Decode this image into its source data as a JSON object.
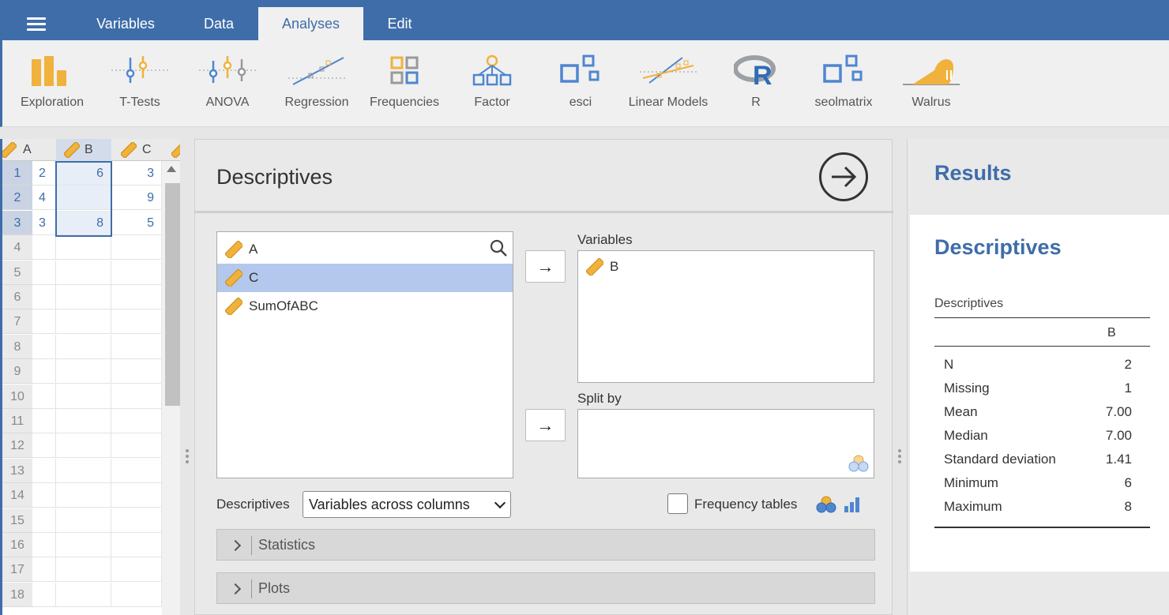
{
  "menu": {
    "tabs": [
      "Variables",
      "Data",
      "Analyses",
      "Edit"
    ],
    "active_tab": "Analyses"
  },
  "ribbon": {
    "items": [
      "Exploration",
      "T-Tests",
      "ANOVA",
      "Regression",
      "Frequencies",
      "Factor",
      "esci",
      "Linear Models",
      "R",
      "seolmatrix",
      "Walrus"
    ]
  },
  "spreadsheet": {
    "columns": [
      "A",
      "B",
      "C"
    ],
    "selected_column": "B",
    "row_numbers": [
      "1",
      "2",
      "3",
      "4",
      "5",
      "6",
      "7",
      "8",
      "9",
      "10",
      "11",
      "12",
      "13",
      "14",
      "15",
      "16",
      "17",
      "18"
    ],
    "rows": [
      [
        "2",
        "6",
        "3"
      ],
      [
        "4",
        "",
        "9"
      ],
      [
        "3",
        "8",
        "5"
      ]
    ]
  },
  "analysis": {
    "title": "Descriptives",
    "available_variables": [
      "A",
      "C",
      "SumOfABC"
    ],
    "selected_available": "C",
    "variables_label": "Variables",
    "variables": [
      "B"
    ],
    "split_by_label": "Split by",
    "arrow": "→",
    "layout_label": "Descriptives",
    "layout_value": "Variables across columns",
    "frequency_tables_label": "Frequency tables",
    "sections": [
      "Statistics",
      "Plots"
    ]
  },
  "results": {
    "title": "Results",
    "heading": "Descriptives",
    "table_caption": "Descriptives",
    "column": "B",
    "rows": [
      {
        "label": "N",
        "value": "2"
      },
      {
        "label": "Missing",
        "value": "1"
      },
      {
        "label": "Mean",
        "value": "7.00"
      },
      {
        "label": "Median",
        "value": "7.00"
      },
      {
        "label": "Standard deviation",
        "value": "1.41"
      },
      {
        "label": "Minimum",
        "value": "6"
      },
      {
        "label": "Maximum",
        "value": "8"
      }
    ]
  },
  "colors": {
    "brand": "#3e6da9",
    "icon_orange": "#f0b23c",
    "selection": "#b3c8ec"
  }
}
